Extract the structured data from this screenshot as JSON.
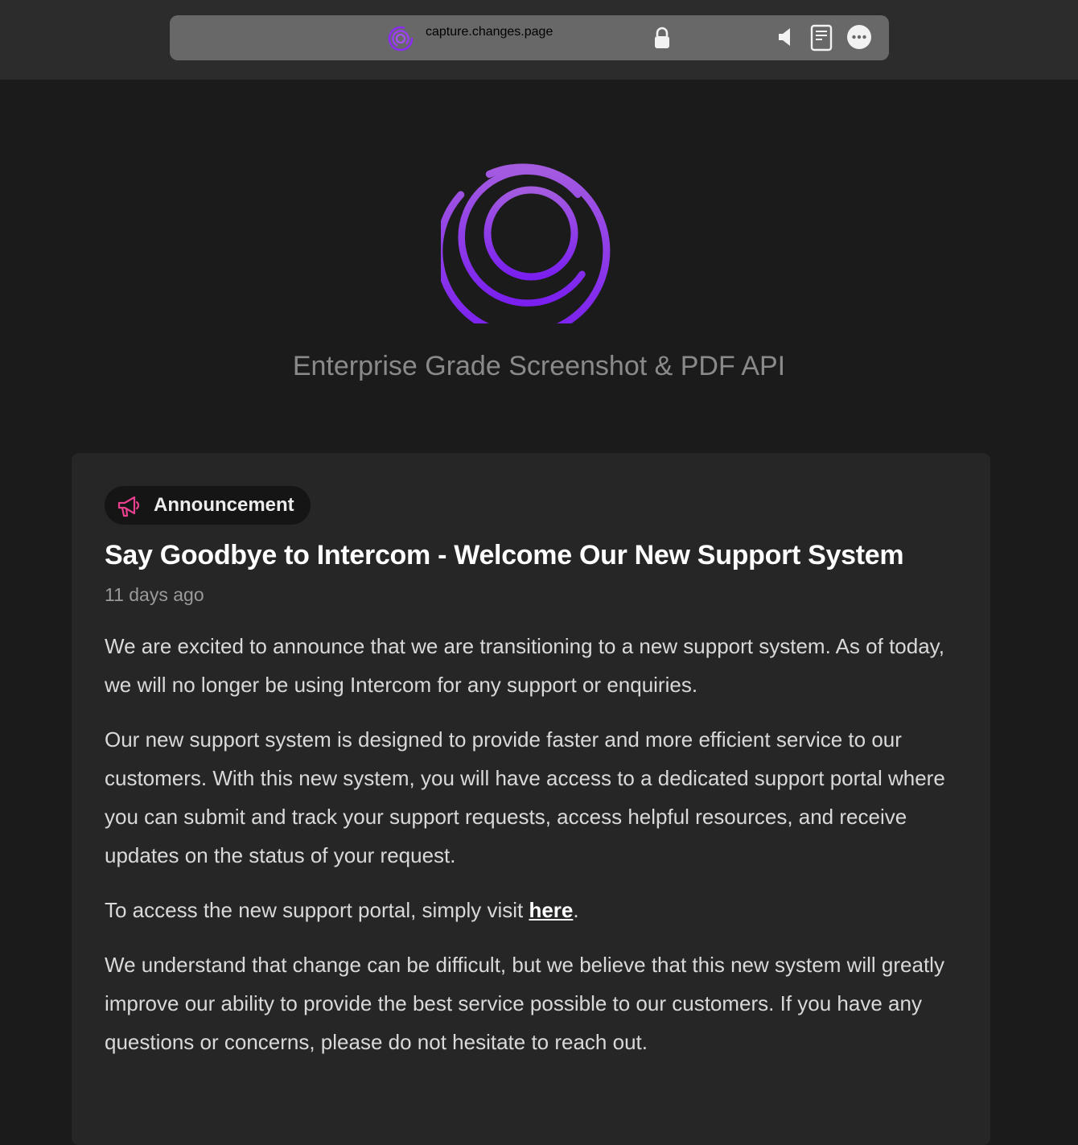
{
  "browser": {
    "url": "capture.changes.page",
    "icons": [
      "site-logo-icon",
      "lock-icon",
      "speaker-icon",
      "reader-icon",
      "more-icon"
    ]
  },
  "header": {
    "tagline": "Enterprise Grade Screenshot & PDF API",
    "logo_icon": "concentric-rings-logo"
  },
  "post": {
    "badge": "Announcement",
    "badge_icon": "megaphone-icon",
    "title": "Say Goodbye to Intercom - Welcome Our New Support System",
    "date": "11 days ago",
    "paragraphs": {
      "p1": "We are excited to announce that we are transitioning to a new support system. As of today, we will no longer be using Intercom for any support or enquiries.",
      "p2": "Our new support system is designed to provide faster and more efficient service to our customers. With this new system, you will have access to a dedicated support portal where you can submit and track your support requests, access helpful resources, and receive updates on the status of your request.",
      "p3_prefix": "To access the new support portal, simply visit ",
      "p3_link": "here",
      "p3_suffix": ".",
      "p4": "We understand that change can be difficult, but we believe that this new system will greatly improve our ability to provide the best service possible to our customers. If you have any questions or concerns, please do not hesitate to reach out."
    }
  },
  "colors": {
    "page_bg": "#1b1b1b",
    "topbar_bg": "#2c2c2c",
    "urlbar_bg": "#686868",
    "card_bg": "#262626",
    "badge_bg": "#151515",
    "accent_purple": "#8b2cf5",
    "badge_icon_pink": "#e8408f",
    "tagline_gray": "#8a8a8a"
  }
}
